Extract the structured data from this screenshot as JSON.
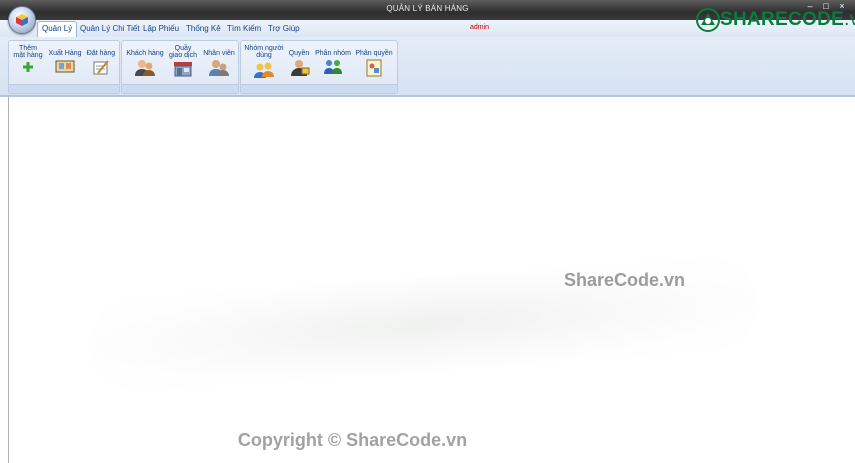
{
  "window": {
    "title": "QUẢN LÝ BÁN HÀNG",
    "controls": [
      "–",
      "□",
      "×"
    ]
  },
  "tabs": [
    {
      "label": "Quản Lý",
      "active": true
    },
    {
      "label": "Quản Lý Chi Tiết",
      "active": false
    },
    {
      "label": "Lập Phiếu",
      "active": false
    },
    {
      "label": "Thống Kê",
      "active": false
    },
    {
      "label": "Tìm Kiếm",
      "active": false
    },
    {
      "label": "Trợ Giúp",
      "active": false
    }
  ],
  "user": {
    "name": "admin",
    "color": "#c00000"
  },
  "ribbon": {
    "groups": [
      {
        "buttons": [
          {
            "label1": "Thêm",
            "label2": "mặt hàng",
            "icon": "add-icon"
          },
          {
            "label1": "Xuất Hàng",
            "label2": "",
            "icon": "export-goods-icon"
          },
          {
            "label1": "Đặt hàng",
            "label2": "",
            "icon": "order-icon"
          }
        ]
      },
      {
        "buttons": [
          {
            "label1": "Khách hàng",
            "label2": "",
            "icon": "customers-icon"
          },
          {
            "label1": "Quầy",
            "label2": "giao dịch",
            "icon": "counter-icon"
          },
          {
            "label1": "Nhân viên",
            "label2": "",
            "icon": "staff-icon"
          }
        ]
      },
      {
        "buttons": [
          {
            "label1": "Nhóm người",
            "label2": "dùng",
            "icon": "user-group-icon"
          },
          {
            "label1": "Quyền",
            "label2": "",
            "icon": "permission-icon"
          },
          {
            "label1": "Phân nhóm",
            "label2": "",
            "icon": "assign-group-icon"
          },
          {
            "label1": "Phân quyền",
            "label2": "",
            "icon": "assign-permission-icon"
          }
        ]
      }
    ]
  },
  "brand": {
    "name": "SHARECODE",
    "suffix": ".vn",
    "color": "#0a7b3e"
  },
  "watermarks": {
    "center": "ShareCode.vn",
    "footer": "Copyright © ShareCode.vn"
  }
}
